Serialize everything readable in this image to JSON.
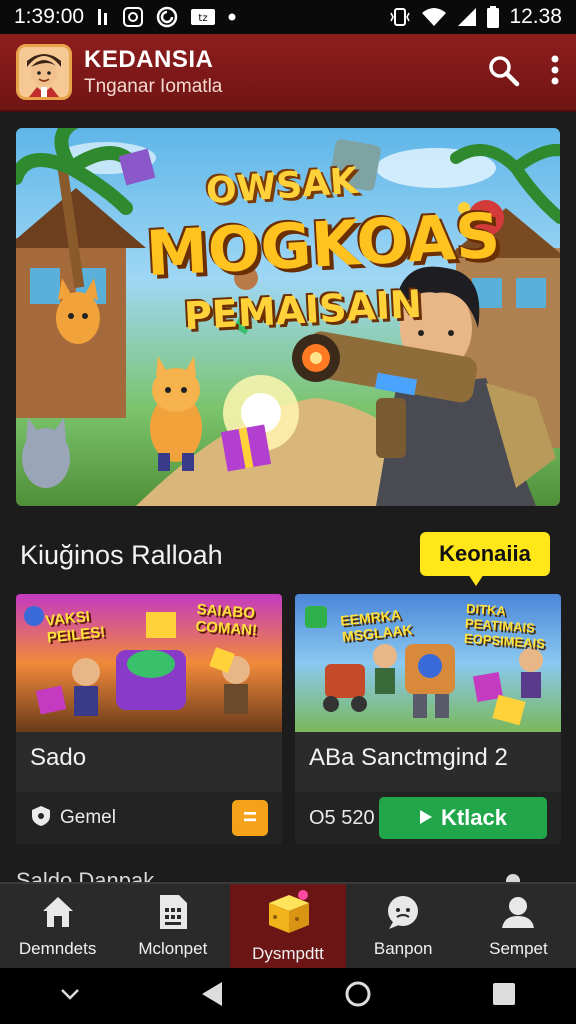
{
  "status_bar": {
    "time_left": "1:39:00",
    "time_right": "12.38",
    "icons": [
      "notification-icon",
      "whatsapp-icon",
      "app-icon",
      "dot-icon",
      "signal-icon",
      "wifi-icon",
      "battery-icon"
    ]
  },
  "app_bar": {
    "title": "KEDANSIA",
    "subtitle": "Tnganar Iоmatla",
    "actions": [
      "search-icon",
      "more-vert-icon"
    ]
  },
  "hero": {
    "line1": "OWSAK",
    "line2": "MOGKOAS",
    "line3": "PEMAISAIN"
  },
  "section": {
    "title": "Kiuğinos Ralloah",
    "badge": "Keonaiia"
  },
  "cards": [
    {
      "thumb_line1": "VAKSI PEILES!",
      "thumb_line2": "SAIABO COMAN!",
      "title": "Sado",
      "footer_label": "Gemel",
      "button": "="
    },
    {
      "thumb_line1": "EEMRKA MSGLAAK",
      "thumb_line2": "DITKA PEATIMAIS EOPSIMEAIS",
      "title": "ABa Sanctmgind 2",
      "price": "O5 520",
      "button": "Ktlack"
    }
  ],
  "peek_text": "Saldo Danрak",
  "bottom_nav": [
    {
      "label": "Demndets",
      "icon": "home-icon",
      "active": false
    },
    {
      "label": "Mclonpet",
      "icon": "document-icon",
      "active": false
    },
    {
      "label": "Dysmpdtt",
      "icon": "gift-cube-icon",
      "active": true
    },
    {
      "label": "Banpon",
      "icon": "chat-face-icon",
      "active": false
    },
    {
      "label": "Sempet",
      "icon": "profile-icon",
      "active": false
    }
  ],
  "colors": {
    "app_bar": "#7e1818",
    "accent_yellow": "#ffe71a",
    "play_green": "#21a74a",
    "orange": "#f4a21a"
  }
}
